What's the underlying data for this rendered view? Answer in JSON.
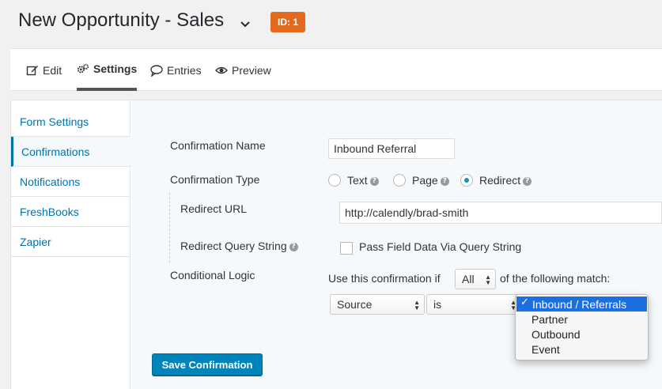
{
  "header": {
    "title": "New Opportunity - Sales",
    "id_badge": "ID: 1"
  },
  "tabs": [
    {
      "label": "Edit",
      "icon": "edit-icon"
    },
    {
      "label": "Settings",
      "icon": "gear-icon",
      "active": true
    },
    {
      "label": "Entries",
      "icon": "speech-bubble-icon"
    },
    {
      "label": "Preview",
      "icon": "eye-icon"
    }
  ],
  "sidebar": {
    "items": [
      {
        "label": "Form Settings"
      },
      {
        "label": "Confirmations",
        "active": true
      },
      {
        "label": "Notifications"
      },
      {
        "label": "FreshBooks"
      },
      {
        "label": "Zapier"
      }
    ]
  },
  "form": {
    "name_label": "Confirmation Name",
    "name_value": "Inbound Referral",
    "type_label": "Confirmation Type",
    "type_options": [
      {
        "label": "Text",
        "checked": false
      },
      {
        "label": "Page",
        "checked": false
      },
      {
        "label": "Redirect",
        "checked": true
      }
    ],
    "redirect_url_label": "Redirect URL",
    "redirect_url_value": "http://calendly/brad-smith",
    "query_string_label": "Redirect Query String",
    "query_string_checkbox_label": "Pass Field Data Via Query String",
    "query_string_checked": false,
    "conditional_label": "Conditional Logic",
    "use_if_text": "Use this confirmation if",
    "match_select_value": "All",
    "following_text": "of the following match:",
    "rule_field_value": "Source",
    "rule_operator_value": "is",
    "save_label": "Save Confirmation"
  },
  "rule_value_dropdown": {
    "options": [
      "Inbound / Referrals",
      "Partner",
      "Outbound",
      "Event"
    ],
    "selected": "Inbound / Referrals"
  },
  "colors": {
    "accent": "#0073aa",
    "button": "#0085ba",
    "badge": "#e26a1f",
    "dropdown_highlight": "#1a6fe3"
  }
}
